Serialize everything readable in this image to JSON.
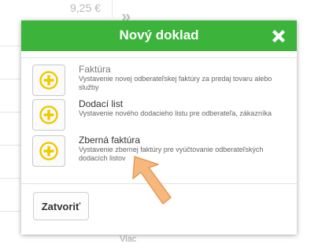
{
  "background": {
    "price": "9,25 €",
    "arrows": "»",
    "more_label": "Viac"
  },
  "dialog": {
    "title": "Nový doklad",
    "close_icon": "close-x-icon",
    "items": [
      {
        "title": "Faktúra",
        "description": "Vystavenie novej odberateľskej faktúry za predaj tovaru alebo služby"
      },
      {
        "title": "Dodací list",
        "description": "Vystavenie nového dodacieho listu pre odberateľa, zákazníka"
      },
      {
        "title": "Zberná faktúra",
        "description": "Vystavenie zbernej faktúry pre vyúčtovanie odberateľských dodacích listov"
      }
    ],
    "close_button_label": "Zatvoriť"
  },
  "colors": {
    "header_green": "#3cb43c",
    "plus_icon_yellow": "#f2c800",
    "pointer_orange": "#f6b87d"
  }
}
